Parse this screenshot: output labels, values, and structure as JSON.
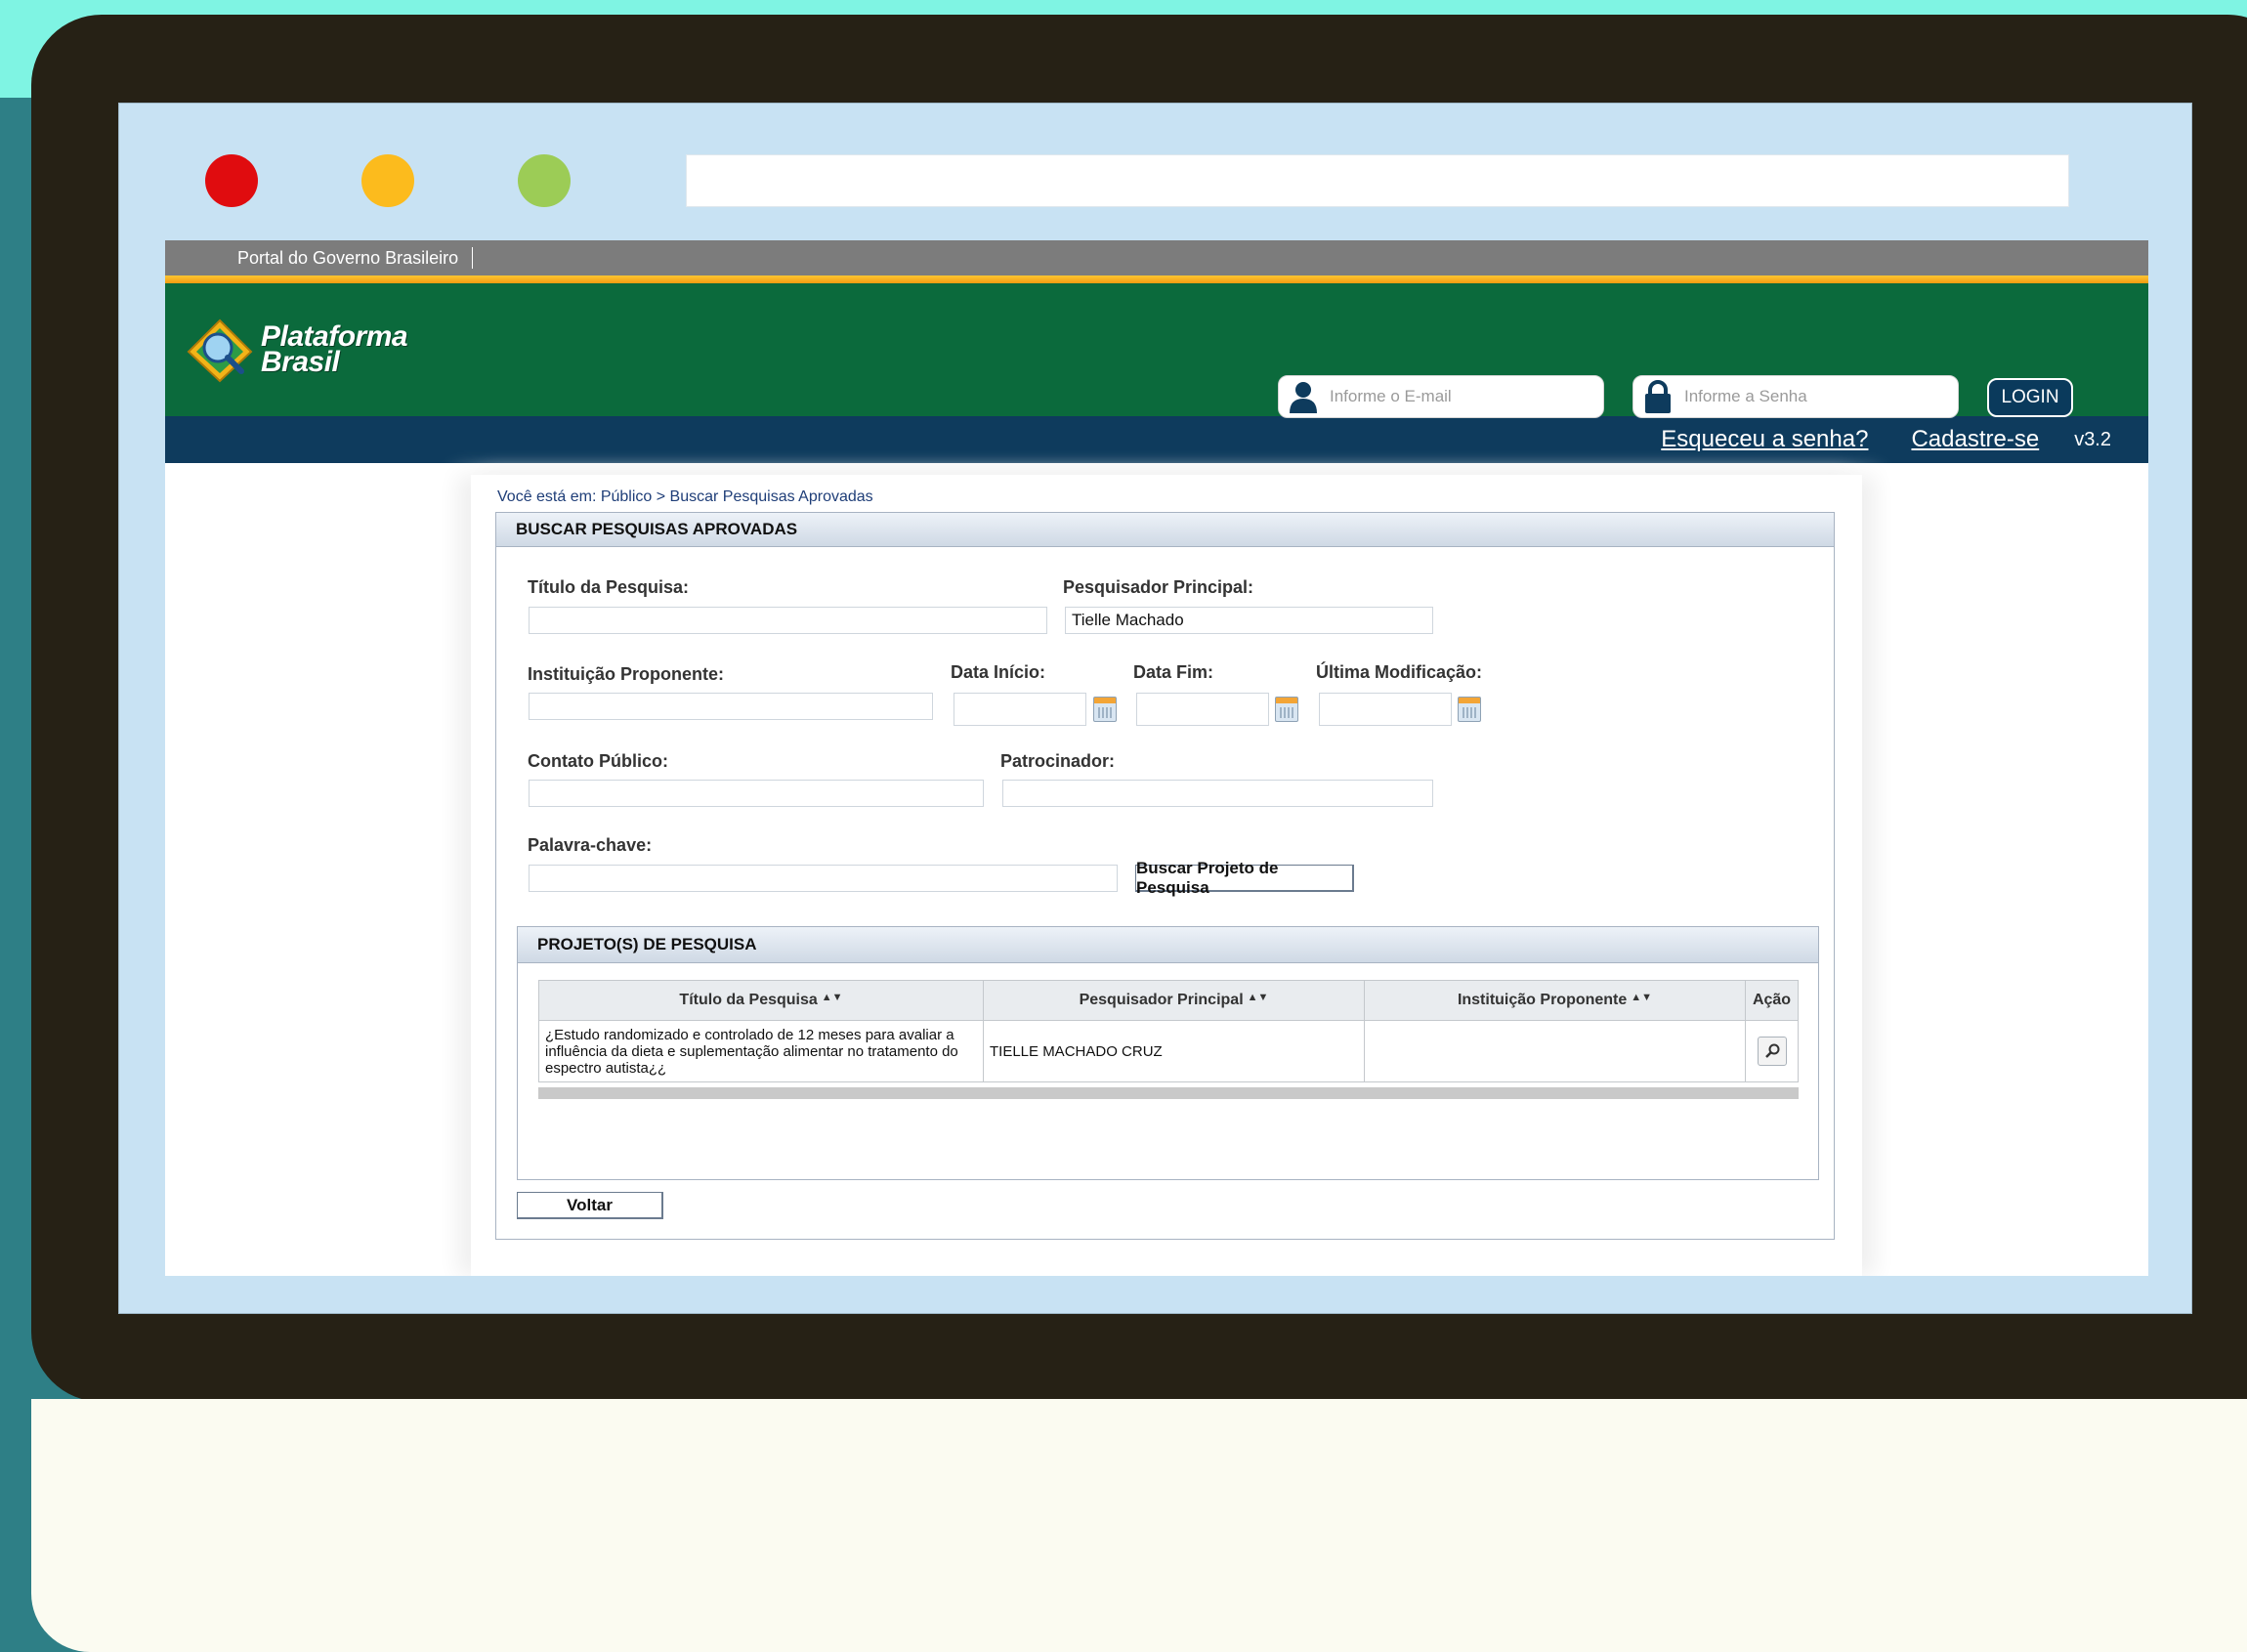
{
  "header": {
    "gov_portal": "Portal do Governo Brasileiro",
    "logo_line1": "Plataforma",
    "logo_line2": "Brasil",
    "email_placeholder": "Informe o E-mail",
    "senha_placeholder": "Informe a Senha",
    "login_label": "LOGIN",
    "forgot_label": "Esqueceu a senha?",
    "register_label": "Cadastre-se",
    "version": "v3.2"
  },
  "breadcrumb": "Você está em: Público > Buscar Pesquisas Aprovadas",
  "search_panel": {
    "title": "BUSCAR PESQUISAS APROVADAS",
    "titulo_label": "Título da Pesquisa:",
    "titulo_value": "",
    "pesquisador_label": "Pesquisador Principal:",
    "pesquisador_value": "Tielle Machado",
    "instituicao_label": "Instituição Proponente:",
    "instituicao_value": "",
    "data_inicio_label": "Data Início:",
    "data_fim_label": "Data Fim:",
    "ultima_mod_label": "Última Modificação:",
    "contato_label": "Contato Público:",
    "patrocinador_label": "Patrocinador:",
    "palavra_label": "Palavra-chave:",
    "search_button": "Buscar Projeto de Pesquisa",
    "back_button": "Voltar"
  },
  "results": {
    "title": "PROJETO(S) DE PESQUISA",
    "columns": [
      "Título da Pesquisa",
      "Pesquisador Principal",
      "Instituição Proponente",
      "Ação"
    ],
    "rows": [
      {
        "titulo": "¿Estudo randomizado e controlado de 12 meses para avaliar a influência da dieta e suplementação alimentar no tratamento do espectro autista¿¿",
        "pesquisador": "TIELLE MACHADO CRUZ",
        "instituicao": ""
      }
    ]
  },
  "colors": {
    "header_green": "#0b6a3c",
    "nav_blue": "#0e3b5d",
    "accent_orange": "#f39c12"
  },
  "icons": [
    "user-icon",
    "lock-icon",
    "calendar-icon",
    "magnifier-icon",
    "sort-icon"
  ]
}
